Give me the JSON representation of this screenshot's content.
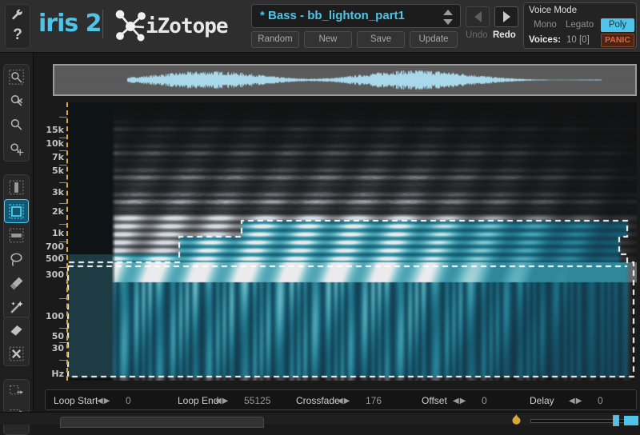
{
  "app": {
    "logo_primary": "iris 2",
    "logo_secondary": "iZotope"
  },
  "topbar": {
    "settings_icon": "wrench-icon",
    "help_icon": "question-mark-icon",
    "preset": {
      "name": "* Bass - bb_lighton_part1",
      "buttons": [
        {
          "label": "Random",
          "name": "random-button"
        },
        {
          "label": "New",
          "name": "new-button"
        },
        {
          "label": "Save",
          "name": "save-button"
        },
        {
          "label": "Update",
          "name": "update-button"
        }
      ]
    },
    "history": {
      "undo_label": "Undo",
      "redo_label": "Redo",
      "undo_enabled": false,
      "redo_enabled": true
    },
    "voice_mode": {
      "title": "Voice Mode",
      "options": [
        "Mono",
        "Legato",
        "Poly"
      ],
      "selected": "Poly",
      "voices_label": "Voices:",
      "voices_value": "10 [0]",
      "panic_label": "PANIC"
    }
  },
  "tools": {
    "groups": [
      {
        "name": "zoom-tools",
        "items": [
          {
            "name": "zoom-fit-icon",
            "active": false
          },
          {
            "name": "zoom-out-icon",
            "active": false
          },
          {
            "name": "zoom-in-icon",
            "active": false
          },
          {
            "name": "zoom-pan-icon",
            "active": false
          }
        ]
      },
      {
        "name": "selection-tools",
        "items": [
          {
            "name": "select-time-icon",
            "active": false
          },
          {
            "name": "select-rectangle-icon",
            "active": true
          },
          {
            "name": "select-frequency-icon",
            "active": false
          },
          {
            "name": "select-lasso-icon",
            "active": false
          },
          {
            "name": "select-brush-icon",
            "active": false
          },
          {
            "name": "select-magic-wand-icon",
            "active": false
          }
        ]
      },
      {
        "name": "edit-tools",
        "items": [
          {
            "name": "eraser-icon",
            "active": false
          },
          {
            "name": "deselect-icon",
            "active": false
          }
        ]
      },
      {
        "name": "transform-tools",
        "items": [
          {
            "name": "selection-move-icon",
            "active": false
          },
          {
            "name": "selection-transform-icon",
            "active": false
          }
        ]
      }
    ]
  },
  "spectrogram": {
    "freq_axis_labels": [
      "15k",
      "10k",
      "7k",
      "5k",
      "3k",
      "2k",
      "1k",
      "700",
      "500",
      "300",
      "100",
      "50",
      "30",
      "Hz"
    ],
    "selection_active": true,
    "colors": {
      "selected": "#4fc3e8",
      "unselected": "#9aa8ad",
      "background": "#0e1416",
      "marquee": "#ffffff",
      "playhead": "#d8a83a"
    }
  },
  "params": [
    {
      "label": "Loop Start",
      "value": "0",
      "name": "loop-start"
    },
    {
      "label": "Loop End",
      "value": "55125",
      "name": "loop-end"
    },
    {
      "label": "Crossfade",
      "value": "176",
      "name": "crossfade"
    },
    {
      "label": "Offset",
      "value": "0",
      "name": "offset"
    },
    {
      "label": "Delay",
      "value": "0",
      "name": "delay"
    }
  ],
  "bottom": {
    "flame_icon": "flame-icon",
    "slider_name": "master-slider"
  },
  "colors": {
    "accent": "#4fc3e8",
    "panel": "#2e2e2e",
    "dark": "#1a1a1a",
    "panic": "#d8693a"
  }
}
